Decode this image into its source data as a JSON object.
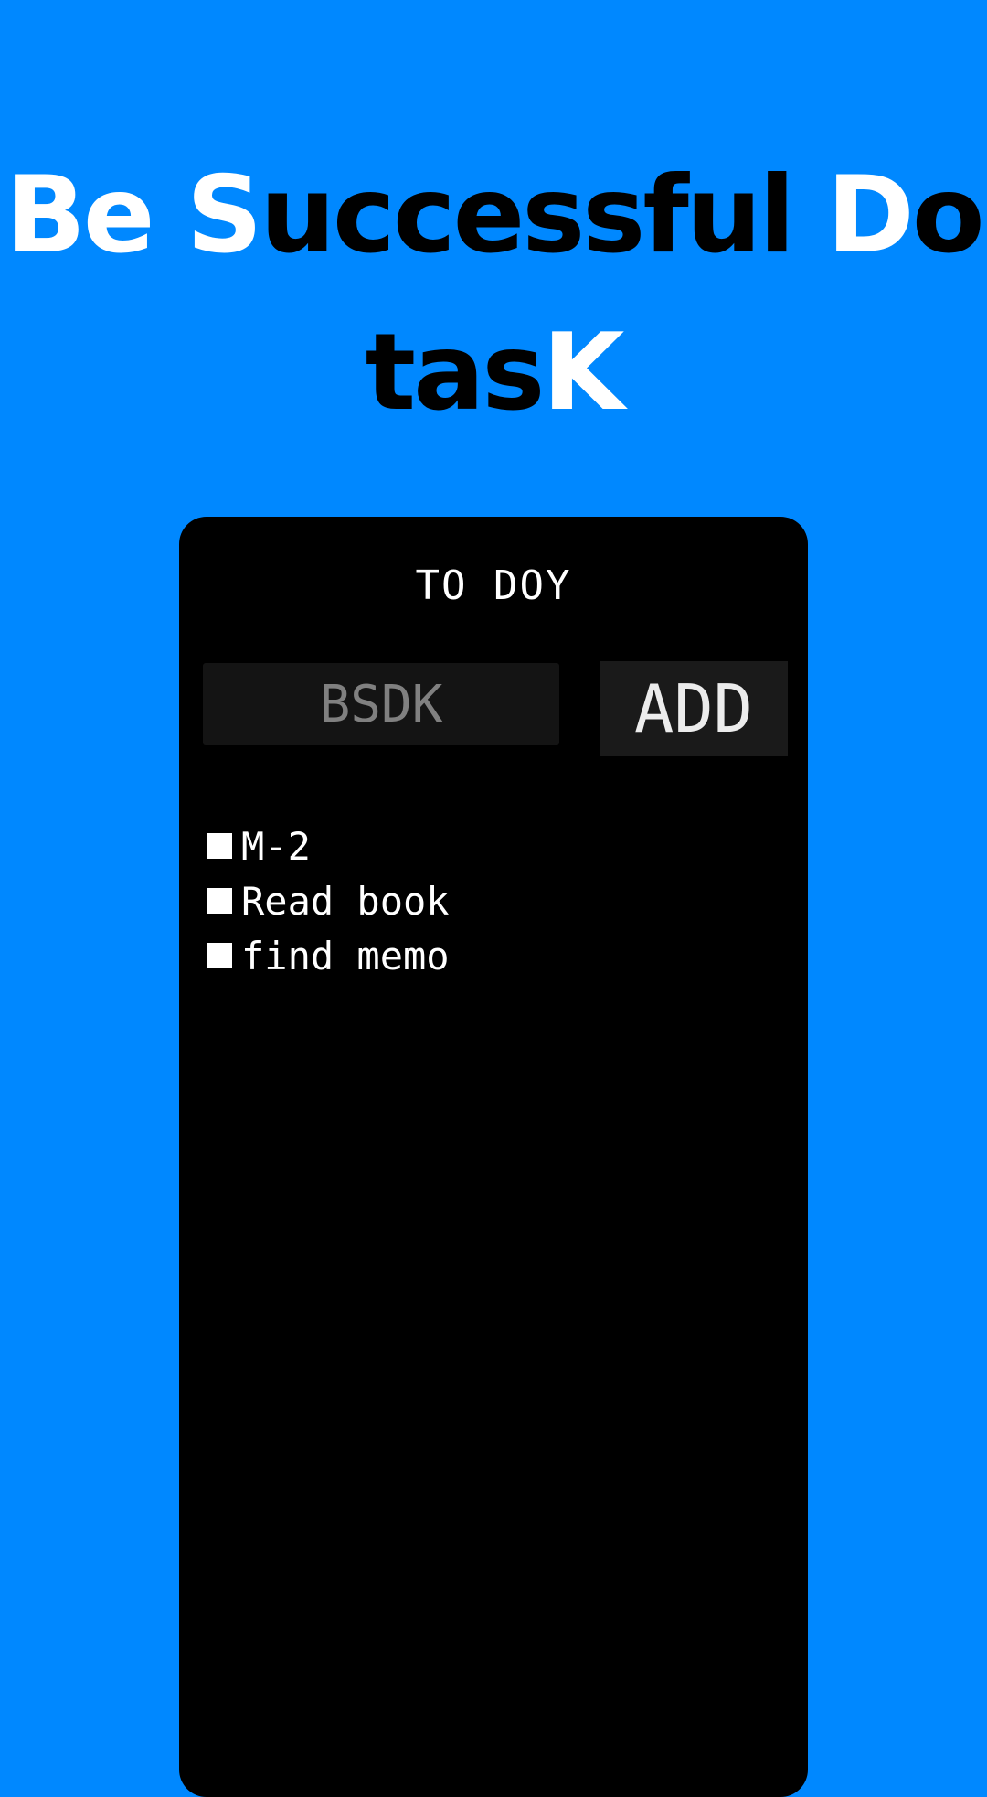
{
  "headline": {
    "line1": [
      {
        "text": "Be ",
        "color": "#ffffff"
      },
      {
        "text": "S",
        "color": "#ffffff"
      },
      {
        "text": "uccessful ",
        "color": "#000000"
      },
      {
        "text": "D",
        "color": "#ffffff"
      },
      {
        "text": "o",
        "color": "#000000"
      }
    ],
    "line2": [
      {
        "text": "tas",
        "color": "#000000"
      },
      {
        "text": "K",
        "color": "#ffffff"
      }
    ]
  },
  "app": {
    "title": "TO DOY",
    "input": {
      "value": "",
      "placeholder": "BSDK"
    },
    "add_label": "ADD",
    "tasks": [
      {
        "label": "M-2"
      },
      {
        "label": "Read book"
      },
      {
        "label": "find memo"
      }
    ]
  },
  "colors": {
    "background": "#0088ff",
    "panel": "#000000",
    "input_bg": "#141414",
    "button_bg": "#1a1a1a"
  }
}
